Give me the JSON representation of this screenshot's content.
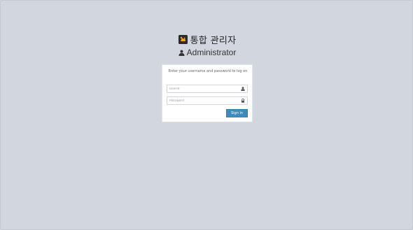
{
  "header": {
    "app_title": "통합 관리자",
    "subtitle": "Administrator",
    "logo_icon": "app-logo-icon",
    "subtitle_icon": "user-icon"
  },
  "login": {
    "message": "Enter your username and password to log on",
    "username": {
      "placeholder": "UserId",
      "value": "",
      "icon": "user-icon"
    },
    "password": {
      "placeholder": "Password",
      "value": "",
      "icon": "lock-icon"
    },
    "signin_label": "Sign in"
  },
  "colors": {
    "background": "#d2d6de",
    "panel": "#ffffff",
    "button": "#3c8dbc",
    "logo_accent": "#f5a623"
  }
}
